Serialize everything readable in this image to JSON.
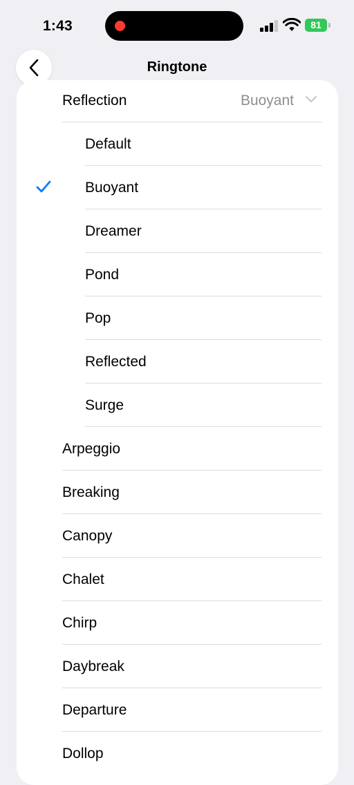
{
  "status_bar": {
    "time": "1:43",
    "battery": "81",
    "icons": [
      "recording-indicator",
      "cellular-signal-icon",
      "wifi-icon",
      "battery-charging-icon"
    ]
  },
  "nav": {
    "title": "Ringtone",
    "back_icon": "chevron-left-icon"
  },
  "group": {
    "label": "Reflection",
    "selected_value": "Buoyant",
    "expand_icon": "chevron-down-icon",
    "variants": [
      "Default",
      "Buoyant",
      "Dreamer",
      "Pond",
      "Pop",
      "Reflected",
      "Surge"
    ],
    "checked_index": 1
  },
  "ringtones": [
    "Arpeggio",
    "Breaking",
    "Canopy",
    "Chalet",
    "Chirp",
    "Daybreak",
    "Departure",
    "Dollop"
  ],
  "colors": {
    "accent": "#007aff",
    "background": "#efeff4",
    "secondary_text": "#8e8e93",
    "battery": "#34c759",
    "recording": "#ff3b30"
  }
}
